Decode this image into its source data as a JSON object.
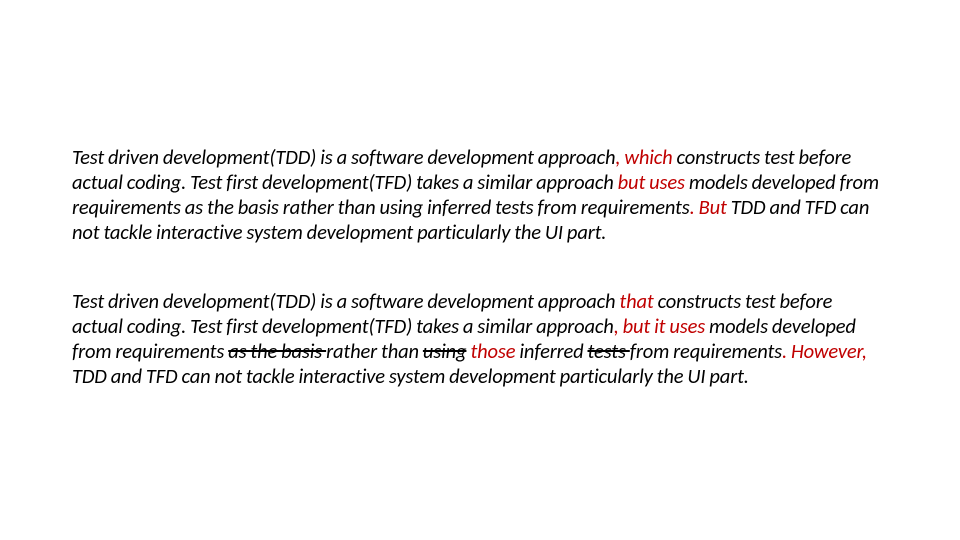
{
  "para1": {
    "s1": "Test driven development(TDD) is a software development approach",
    "s2": ", which",
    "s3": " constructs test before actual coding. Test first development(TFD) takes a similar approach ",
    "s4": "but uses",
    "s5": " models developed from requirements as the basis rather than using inferred tests from requirements",
    "s6": ". But",
    "s7": " TDD and TFD can not tackle interactive system development particularly the UI part."
  },
  "para2": {
    "s1": "Test driven development(TDD) is a software development approach ",
    "s2": "that",
    "s3": " constructs test before actual coding. Test first development(TFD) takes a similar approach",
    "s4": ", but it uses",
    "s5": " models developed from requirements ",
    "s6": "as the basis ",
    "s7": "rather than ",
    "s8": "using",
    "s9": " ",
    "s10": "those",
    "s11": " inferred ",
    "s12": "tests ",
    "s13": "from requirements",
    "s14": ". However,",
    "s15": " TDD and TFD can not tackle interactive system development particularly the UI part."
  }
}
